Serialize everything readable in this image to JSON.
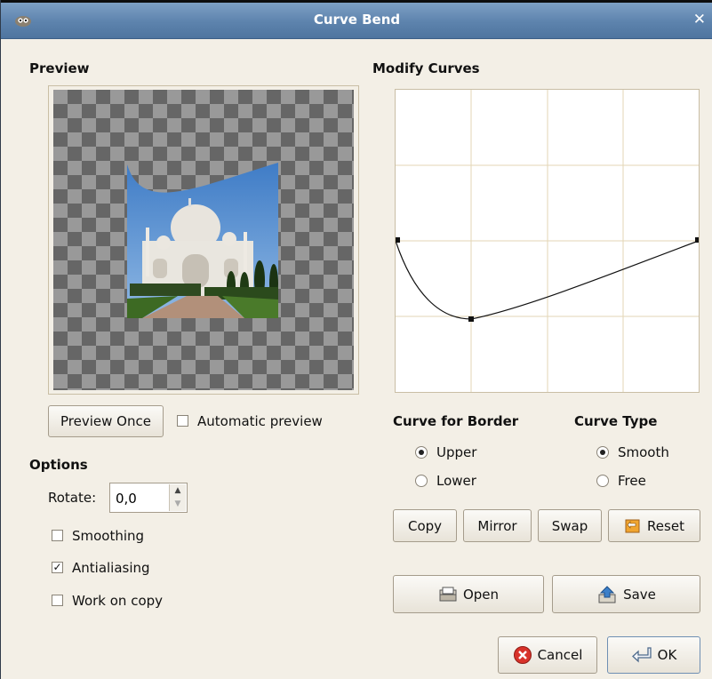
{
  "window": {
    "title": "Curve Bend"
  },
  "preview": {
    "heading": "Preview",
    "preview_once_label": "Preview Once",
    "automatic_preview_label": "Automatic preview",
    "automatic_preview_checked": false
  },
  "modify": {
    "heading": "Modify Curves"
  },
  "options": {
    "heading": "Options",
    "rotate_label": "Rotate:",
    "rotate_value": "0,0",
    "smoothing_label": "Smoothing",
    "smoothing_checked": false,
    "antialiasing_label": "Antialiasing",
    "antialiasing_checked": true,
    "work_on_copy_label": "Work on copy",
    "work_on_copy_checked": false
  },
  "curve_for_border": {
    "heading": "Curve for Border",
    "options": [
      "Upper",
      "Lower"
    ],
    "selected": "Upper"
  },
  "curve_type": {
    "heading": "Curve Type",
    "options": [
      "Smooth",
      "Free"
    ],
    "selected": "Smooth"
  },
  "buttons": {
    "copy": "Copy",
    "mirror": "Mirror",
    "swap": "Swap",
    "reset": "Reset",
    "open": "Open",
    "save": "Save",
    "cancel": "Cancel",
    "ok": "OK"
  },
  "icons": [
    "app-icon",
    "close-icon",
    "reset-icon",
    "open-icon",
    "save-icon",
    "cancel-icon",
    "ok-icon"
  ],
  "colors": {
    "titlebar": "#5d83ad",
    "dialog_bg": "#f3efe6",
    "grid_line": "#e6d9b9"
  }
}
